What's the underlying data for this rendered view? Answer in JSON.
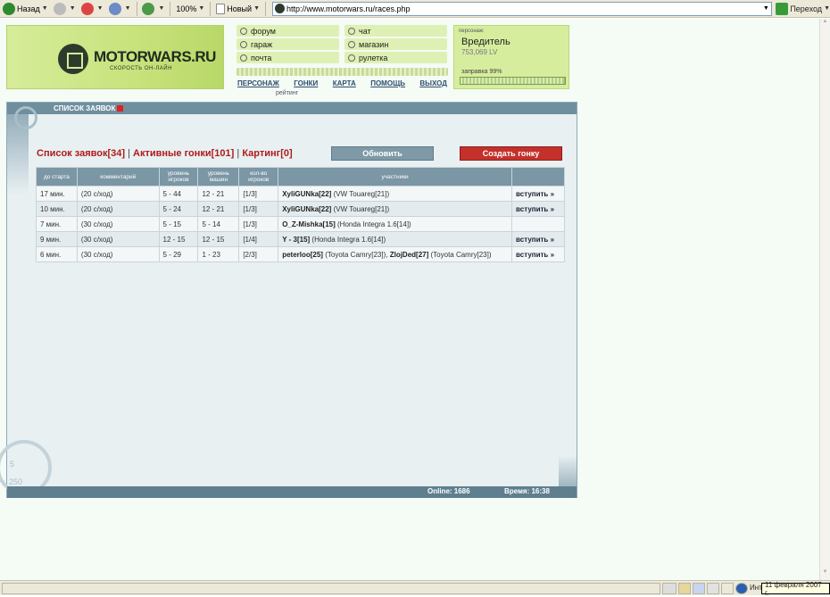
{
  "browser": {
    "back_label": "Назад",
    "zoom": "100%",
    "new_label": "Новый",
    "url": "http://www.motorwars.ru/races.php",
    "go_label": "Переход"
  },
  "site": {
    "logo_name": "MOTORWARS.RU",
    "logo_sub": "СКОРОСТЬ ОН-ЛАЙН",
    "menu": [
      "форум",
      "чат",
      "гараж",
      "магазин",
      "почта",
      "рулетка"
    ],
    "nav": [
      "ПЕРСОНАЖ",
      "ГОНКИ",
      "КАРТА",
      "ПОМОЩЬ",
      "ВЫХОД"
    ],
    "nav_sub": "рейтинг",
    "person_label": "персонаж:",
    "person_name": "Вредитель",
    "person_money": "753,069 LV",
    "fuel_label": "заправка 99%",
    "fuel_level": 0.99
  },
  "panel": {
    "title": "СПИСОК ЗАЯВОК",
    "links": [
      "Список заявок[34]",
      "Активные гонки[101]",
      "Картинг[0]"
    ],
    "update_button": "Обновить",
    "create_button": "Создать гонку",
    "columns": [
      "до старта",
      "комментарий",
      "уровень игроков",
      "уровень машин",
      "кол-во игроков",
      "участники",
      ""
    ],
    "rows": [
      {
        "start": "17 мин.",
        "comment": "(20 с/ход)",
        "plevel": "5 - 44",
        "clevel": "12 - 21",
        "count": "[1/3]",
        "p1": "XyliGUNka[22]",
        "c1": "(VW Touareg[21])",
        "p2": "",
        "c2": "",
        "join": "вступить »"
      },
      {
        "start": "10 мин.",
        "comment": "(20 с/ход)",
        "plevel": "5 - 24",
        "clevel": "12 - 21",
        "count": "[1/3]",
        "p1": "XyliGUNka[22]",
        "c1": "(VW Touareg[21])",
        "p2": "",
        "c2": "",
        "join": "вступить »"
      },
      {
        "start": "7 мин.",
        "comment": "(30 с/ход)",
        "plevel": "5 - 15",
        "clevel": "5 - 14",
        "count": "[1/3]",
        "p1": "O_Z-Mishka[15]",
        "c1": "(Honda Integra 1.6[14])",
        "p2": "",
        "c2": "",
        "join": ""
      },
      {
        "start": "9 мин.",
        "comment": "(30 с/ход)",
        "plevel": "12 - 15",
        "clevel": "12 - 15",
        "count": "[1/4]",
        "p1": "Y - 3[15]",
        "c1": "(Honda Integra 1.6[14])",
        "p2": "",
        "c2": "",
        "join": "вступить »"
      },
      {
        "start": "6 мин.",
        "comment": "(30 с/ход)",
        "plevel": "5 - 29",
        "clevel": "1 - 23",
        "count": "[2/3]",
        "p1": "peterloo[25]",
        "c1": "(Toyota Camry[23]),",
        "p2": "ZlojDed[27]",
        "c2": "(Toyota Camry[23])",
        "join": "вступить »"
      }
    ],
    "online": "Online: 1686",
    "time": "Время: 16:38",
    "gauge_5": "5",
    "gauge_250": "250"
  },
  "statusbar": {
    "zone": "Инт",
    "date": "11 февраля 2007 г."
  }
}
